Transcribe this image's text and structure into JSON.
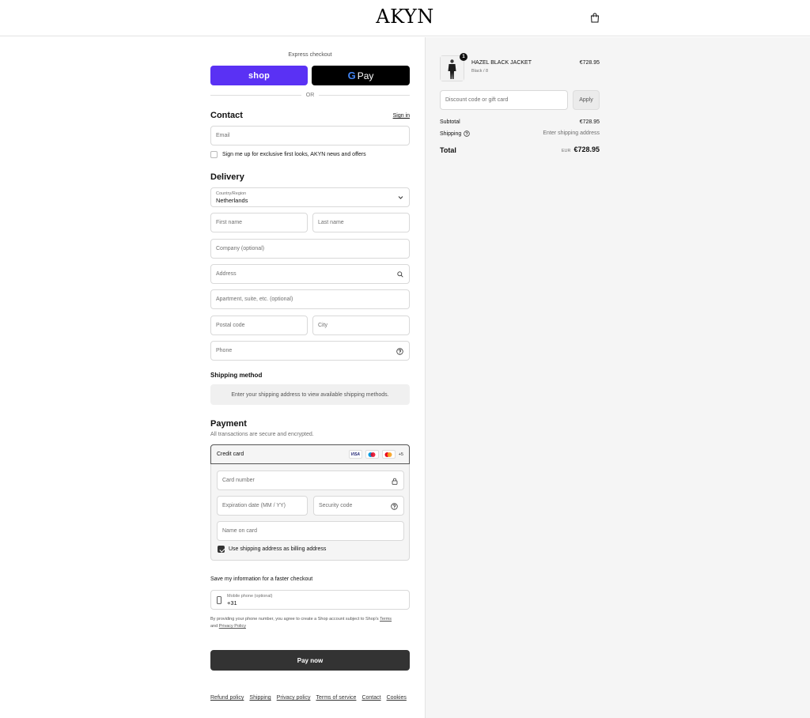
{
  "header": {
    "logo": "AKYN",
    "cart_icon": "shopping-bag-icon"
  },
  "express": {
    "label": "Express checkout",
    "shop_label": "shop",
    "gpay_g": "G",
    "gpay_label": "Pay",
    "or_label": "OR"
  },
  "contact": {
    "title": "Contact",
    "signin": "Sign in",
    "email_placeholder": "Email",
    "newsletter_label": "Sign me up for exclusive first looks, AKYN news and offers"
  },
  "delivery": {
    "title": "Delivery",
    "country_label": "Country/Region",
    "country_value": "Netherlands",
    "first_name": "First name",
    "last_name": "Last name",
    "company": "Company (optional)",
    "address": "Address",
    "apartment": "Apartment, suite, etc. (optional)",
    "postal": "Postal code",
    "city": "City",
    "phone": "Phone"
  },
  "shipping_method": {
    "title": "Shipping method",
    "message": "Enter your shipping address to view available shipping methods."
  },
  "payment": {
    "title": "Payment",
    "subtitle": "All transactions are secure and encrypted.",
    "method": "Credit card",
    "visa": "VISA",
    "more_cards": "+5",
    "card_number": "Card number",
    "expiry": "Expiration date (MM / YY)",
    "security": "Security code",
    "name_on_card": "Name on card",
    "billing_same": "Use shipping address as billing address"
  },
  "save_info": {
    "title": "Save my information for a faster checkout",
    "mobile_label": "Mobile phone (optional)",
    "mobile_value": "+31",
    "disclaimer_pre": "By providing your phone number, you agree to create a Shop account subject to Shop's",
    "terms": "Terms",
    "and": "and",
    "privacy": "Privacy Policy"
  },
  "pay_now": "Pay now",
  "footer": [
    "Refund policy",
    "Shipping",
    "Privacy policy",
    "Terms of service",
    "Contact",
    "Cookies"
  ],
  "summary": {
    "quantity": "1",
    "product_name": "HAZEL BLACK JACKET",
    "variant": "Black / 8",
    "price": "€728.95",
    "discount_placeholder": "Discount code or gift card",
    "apply": "Apply",
    "subtotal_label": "Subtotal",
    "subtotal_value": "€728.95",
    "shipping_label": "Shipping",
    "shipping_value": "Enter shipping address",
    "total_label": "Total",
    "currency": "EUR",
    "total_value": "€728.95"
  }
}
